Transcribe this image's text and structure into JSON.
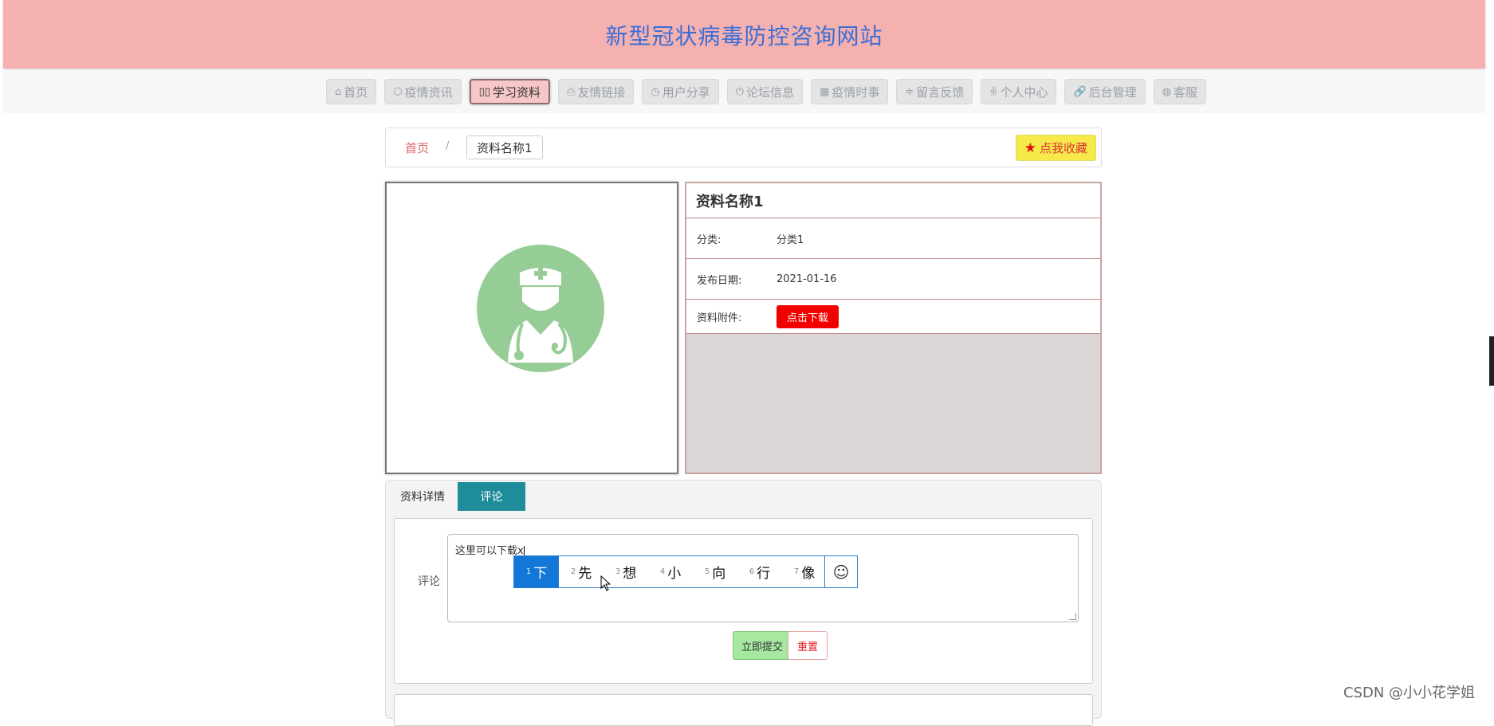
{
  "header": {
    "title": "新型冠状病毒防控咨询网站"
  },
  "nav": [
    {
      "label": "首页",
      "icon": "home-icon",
      "glyph": "⌂"
    },
    {
      "label": "疫情资讯",
      "icon": "box-icon",
      "glyph": "⬡"
    },
    {
      "label": "学习资料",
      "icon": "book-icon",
      "glyph": "▯▯",
      "active": true
    },
    {
      "label": "友情链接",
      "icon": "print-icon",
      "glyph": "⎙"
    },
    {
      "label": "用户分享",
      "icon": "chat-icon",
      "glyph": "◷"
    },
    {
      "label": "论坛信息",
      "icon": "power-icon",
      "glyph": "⏻"
    },
    {
      "label": "疫情时事",
      "icon": "calendar-icon",
      "glyph": "▦"
    },
    {
      "label": "留言反馈",
      "icon": "sliders-icon",
      "glyph": "≑"
    },
    {
      "label": "个人中心",
      "icon": "user-icon",
      "glyph": "ꆜ"
    },
    {
      "label": "后台管理",
      "icon": "link-icon",
      "glyph": "🔗"
    },
    {
      "label": "客服",
      "icon": "globe-icon",
      "glyph": "◍"
    }
  ],
  "breadcrumb": {
    "home": "首页",
    "separator": "/",
    "current": "资料名称1"
  },
  "favorite_button": "点我收藏",
  "detail": {
    "title": "资料名称1",
    "rows": [
      {
        "label": "分类:",
        "value": "分类1"
      },
      {
        "label": "发布日期:",
        "value": "2021-01-16"
      }
    ],
    "attachment_label": "资料附件:",
    "download_button": "点击下载"
  },
  "tabs": {
    "detail": "资料详情",
    "comment": "评论"
  },
  "comment": {
    "label": "评论",
    "text": "这里可以下载x",
    "submit": "立即提交",
    "reset": "重置"
  },
  "ime": {
    "candidates": [
      {
        "num": "1",
        "text": "下"
      },
      {
        "num": "2",
        "text": "先"
      },
      {
        "num": "3",
        "text": "想"
      },
      {
        "num": "4",
        "text": "小"
      },
      {
        "num": "5",
        "text": "向"
      },
      {
        "num": "6",
        "text": "行"
      },
      {
        "num": "7",
        "text": "像"
      }
    ],
    "emoji": "☺"
  },
  "watermark": "CSDN @小小花学姐",
  "colors": {
    "header_bg": "#f5b0b0",
    "title": "#3b6fd6",
    "avatar_circle": "#96cc96",
    "download": "#f20000",
    "tab_active": "#1e8c9a",
    "favorite": "#f5ea4a"
  }
}
